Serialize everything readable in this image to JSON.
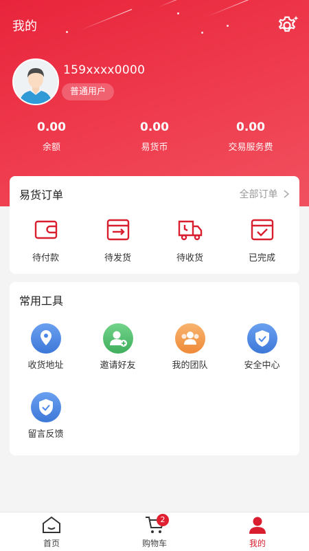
{
  "header": {
    "title": "我的"
  },
  "user": {
    "phone": "159xxxx0000",
    "level": "普通用户"
  },
  "stats": [
    {
      "value": "0.00",
      "label": "余额"
    },
    {
      "value": "0.00",
      "label": "易货币"
    },
    {
      "value": "0.00",
      "label": "交易服务费"
    }
  ],
  "orders": {
    "title": "易货订单",
    "all_label": "全部订单",
    "items": [
      {
        "label": "待付款",
        "icon": "wallet-icon"
      },
      {
        "label": "待发货",
        "icon": "ship-box-icon"
      },
      {
        "label": "待收货",
        "icon": "delivery-truck-icon"
      },
      {
        "label": "已完成",
        "icon": "completed-box-icon"
      }
    ]
  },
  "tools": {
    "title": "常用工具",
    "items": [
      {
        "label": "收货地址",
        "icon": "location-pin-icon",
        "color": "#4a86e8"
      },
      {
        "label": "邀请好友",
        "icon": "add-user-icon",
        "color": "#4fbf6a"
      },
      {
        "label": "我的团队",
        "icon": "team-icon",
        "color": "#f39a4a"
      },
      {
        "label": "安全中心",
        "icon": "shield-check-icon",
        "color": "#4a86e8"
      },
      {
        "label": "留言反馈",
        "icon": "shield-check-icon",
        "color": "#4a86e8"
      }
    ]
  },
  "tabbar": {
    "items": [
      {
        "label": "首页",
        "icon": "home-icon"
      },
      {
        "label": "购物车",
        "icon": "cart-icon",
        "badge": "2"
      },
      {
        "label": "我的",
        "icon": "profile-icon",
        "active": true
      }
    ]
  },
  "colors": {
    "brand": "#e8243b",
    "active": "#d81e2f"
  }
}
